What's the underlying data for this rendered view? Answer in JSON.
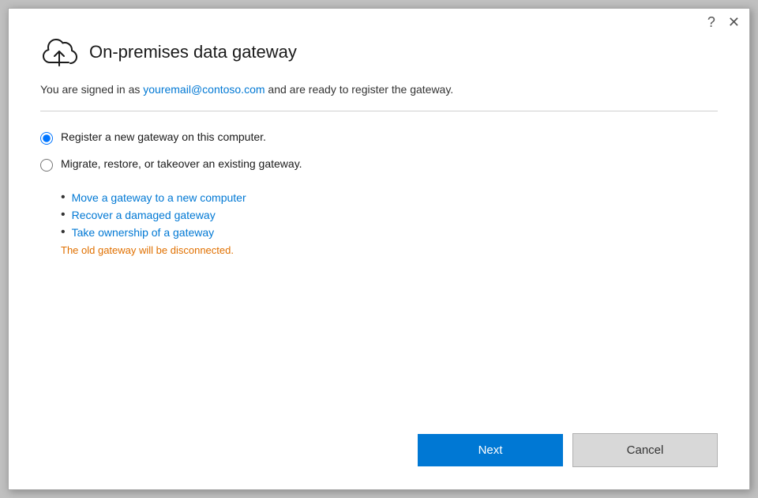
{
  "dialog": {
    "title": "On-premises data gateway",
    "subtitle_pre": "You are signed in as ",
    "subtitle_email": "youremail@contoso.com",
    "subtitle_post": " and are ready to register the gateway."
  },
  "options": {
    "register_label": "Register a new gateway on this computer.",
    "migrate_label": "Migrate, restore, or takeover an existing gateway.",
    "bullet1": "Move a gateway to a new computer",
    "bullet2": "Recover a damaged gateway",
    "bullet3": "Take ownership of a gateway",
    "disconnect_note": "The old gateway will be disconnected."
  },
  "footer": {
    "next_label": "Next",
    "cancel_label": "Cancel"
  },
  "icons": {
    "help": "?",
    "close": "✕"
  }
}
